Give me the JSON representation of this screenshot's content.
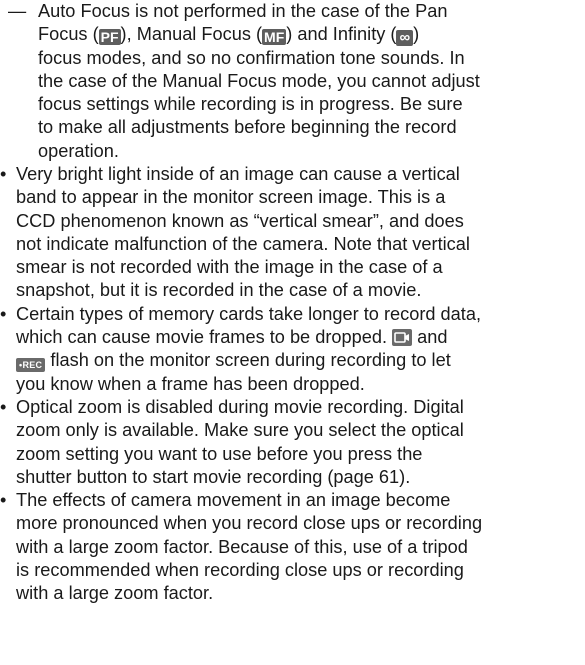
{
  "note": {
    "dash": "—",
    "line1_a": "Auto Focus is not performed in the case of the Pan",
    "line2_a": "Focus (",
    "pf_badge": "PF",
    "line2_b": "), Manual Focus (",
    "mf_badge": "MF",
    "line2_c": ") and Infinity (",
    "inf_badge": "∞",
    "line2_d": ")",
    "line3": "focus modes, and so no confirmation tone sounds. In",
    "line4": "the case of the Manual Focus mode, you cannot adjust",
    "line5": "focus settings while recording is in progress. Be sure",
    "line6": "to make all adjustments before beginning the record",
    "line7": "operation."
  },
  "bullets": [
    {
      "lines": [
        "Very bright light inside of an image can cause a vertical",
        "band to appear in the monitor screen image. This is a",
        "CCD phenomenon known as “vertical smear”, and does",
        "not indicate malfunction of the camera. Note that vertical",
        "smear is not recorded with the image in the case of a",
        "snapshot, but it is recorded in the case of a movie."
      ]
    },
    {
      "line1": "Certain types of memory cards take longer to record data,",
      "line2_a": "which can cause movie frames to be dropped.",
      "movie_icon": "movie-frame-icon",
      "line2_b": "and",
      "rec_badge": "•REC",
      "line3": "flash on the monitor screen during recording to let",
      "line4": "you know when a frame has been dropped."
    },
    {
      "lines": [
        "Optical zoom is disabled during movie recording. Digital",
        "zoom only is available. Make sure you select the optical",
        "zoom setting you want to use before you press the",
        "shutter button to start movie recording (page 61)."
      ]
    },
    {
      "lines": [
        "The effects of camera movement in an image become",
        "more pronounced when you record close ups or recording",
        "with a large zoom factor. Because of this, use of a tripod",
        "is recommended when recording close ups or recording",
        "with a large zoom factor."
      ]
    }
  ],
  "bullet_glyph": "•"
}
